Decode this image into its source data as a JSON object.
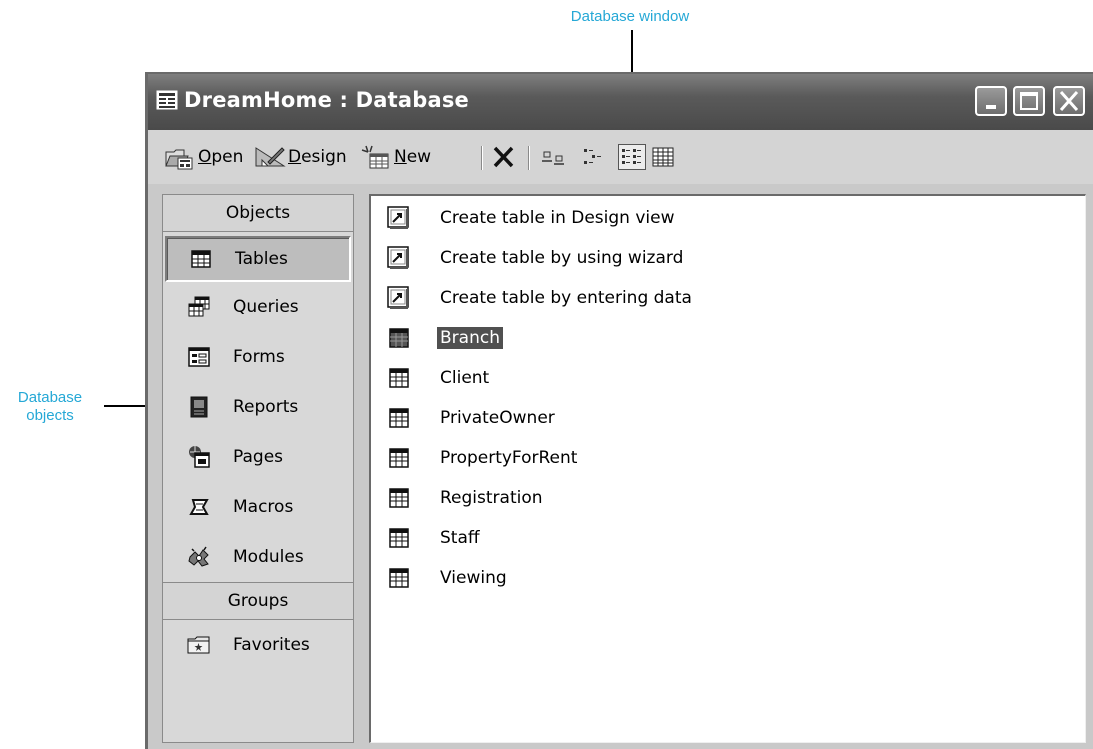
{
  "annotations": {
    "window_label": "Database window",
    "objects_label_line1": "Database",
    "objects_label_line2": "objects"
  },
  "window": {
    "title": "DreamHome : Database",
    "controls": [
      "minimize-icon",
      "maximize-icon",
      "close-icon"
    ]
  },
  "toolbar": {
    "open": {
      "accel": "O",
      "rest": "pen"
    },
    "design": {
      "accel": "D",
      "rest": "esign"
    },
    "new": {
      "accel": "N",
      "rest": "ew"
    },
    "views": [
      "large-icons-view-icon",
      "small-icons-view-icon",
      "list-view-icon",
      "details-view-icon"
    ],
    "active_view": "list-view-icon"
  },
  "objects_panel": {
    "objects_header": "Objects",
    "items": [
      {
        "label": "Tables",
        "icon": "table-icon",
        "selected": true
      },
      {
        "label": "Queries",
        "icon": "query-icon"
      },
      {
        "label": "Forms",
        "icon": "form-icon"
      },
      {
        "label": "Reports",
        "icon": "report-icon"
      },
      {
        "label": "Pages",
        "icon": "page-icon"
      },
      {
        "label": "Macros",
        "icon": "macro-icon"
      },
      {
        "label": "Modules",
        "icon": "module-icon"
      }
    ],
    "groups_header": "Groups",
    "groups": [
      {
        "label": "Favorites",
        "icon": "favorites-folder-icon"
      }
    ]
  },
  "object_list": [
    {
      "label": "Create table in Design view",
      "icon": "shortcut-icon"
    },
    {
      "label": "Create table by using wizard",
      "icon": "shortcut-icon"
    },
    {
      "label": "Create table by entering data",
      "icon": "shortcut-icon"
    },
    {
      "label": "Branch",
      "icon": "table-icon",
      "selected": true
    },
    {
      "label": "Client",
      "icon": "table-icon"
    },
    {
      "label": "PrivateOwner",
      "icon": "table-icon"
    },
    {
      "label": "PropertyForRent",
      "icon": "table-icon"
    },
    {
      "label": "Registration",
      "icon": "table-icon"
    },
    {
      "label": "Staff",
      "icon": "table-icon"
    },
    {
      "label": "Viewing",
      "icon": "table-icon"
    }
  ],
  "colors": {
    "annotation": "#25a8d6",
    "titlebar": "#5a5a5a",
    "selection": "#505050"
  }
}
